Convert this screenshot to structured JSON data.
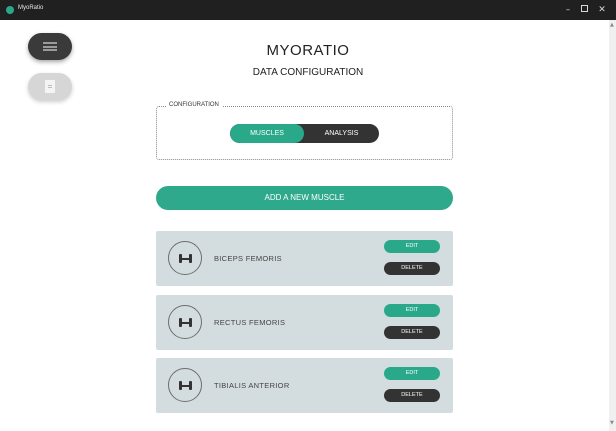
{
  "window": {
    "title": "MyoRatio",
    "minimize_glyph": "–",
    "close_glyph": "✕",
    "brand_color": "#2aa88a"
  },
  "sidebar": {
    "menu_icon": "hamburger-menu-icon",
    "file_icon": "document-icon"
  },
  "header": {
    "app_name": "MYORATIO",
    "subtitle": "DATA CONFIGURATION"
  },
  "configuration": {
    "legend": "CONFIGURATION",
    "options": [
      "MUSCLES",
      "ANALYSIS"
    ],
    "selected": "MUSCLES"
  },
  "add_button_label": "ADD A NEW MUSCLE",
  "muscles": [
    {
      "name": "BICEPS FEMORIS",
      "edit_label": "EDIT",
      "delete_label": "DELETE"
    },
    {
      "name": "RECTUS FEMORIS",
      "edit_label": "EDIT",
      "delete_label": "DELETE"
    },
    {
      "name": "TIBIALIS ANTERIOR",
      "edit_label": "EDIT",
      "delete_label": "DELETE"
    }
  ],
  "scrollbar": {
    "up_glyph": "▲",
    "down_glyph": "▼"
  }
}
